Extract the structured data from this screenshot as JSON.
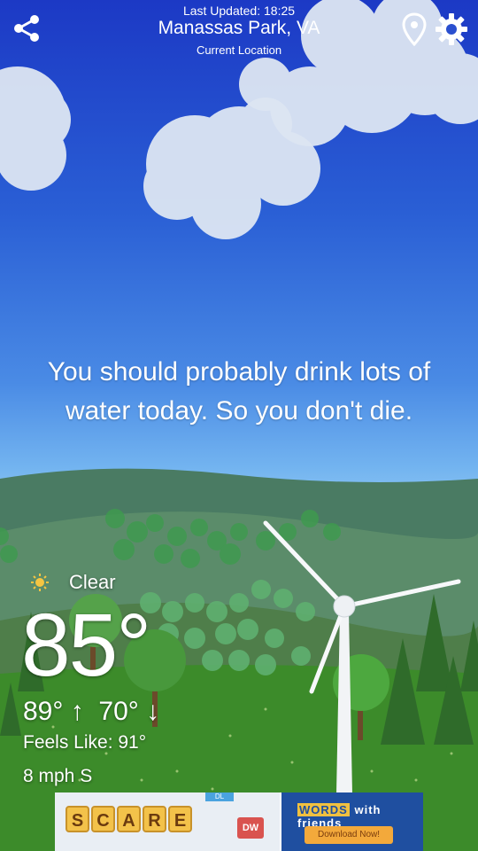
{
  "header": {
    "last_updated": "Last Updated: 18:25",
    "city": "Manassas Park, VA",
    "location_label": "Current Location"
  },
  "icons": {
    "share": "share-icon",
    "location": "location-pin-icon",
    "settings": "gear-icon"
  },
  "message": "You should probably drink lots of water today. So you don't die.",
  "weather": {
    "condition": "Clear",
    "temperature": "85°",
    "high": "89°",
    "high_arrow": "↑",
    "low": "70°",
    "low_arrow": "↓",
    "feels_like": "Feels Like: 91°",
    "wind": "8 mph S"
  },
  "ad": {
    "tiles": [
      "S",
      "C",
      "A",
      "R",
      "E"
    ],
    "dw_label": "DW",
    "dl_label": "DL",
    "brand_word": "WORDS",
    "brand_suffix": "with friends",
    "cta": "Download Now!"
  },
  "colors": {
    "sky_top": "#1c39c5",
    "sky_bottom": "#8fc7f3",
    "grass": "#3c8b2a"
  }
}
